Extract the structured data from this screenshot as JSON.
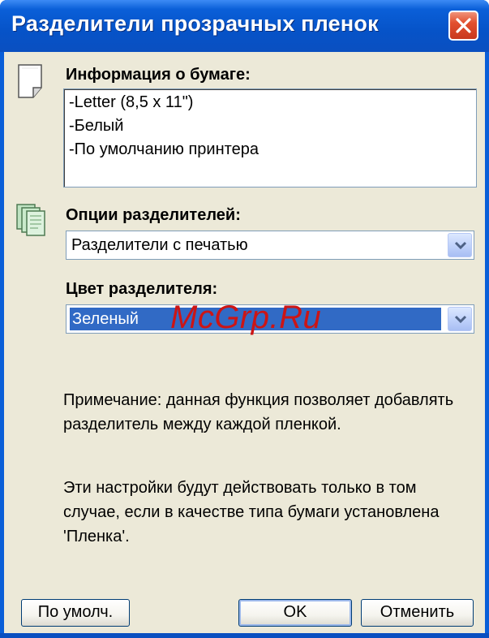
{
  "window": {
    "title": "Разделители прозрачных пленок",
    "close_icon": "close-icon"
  },
  "paper_info": {
    "label": "Информация о бумаге:",
    "icon": "paper-icon",
    "lines": [
      "-Letter (8,5 x 11\")",
      "-Белый",
      "-По умолчанию принтера"
    ]
  },
  "separator_options": {
    "label": "Опции разделителей:",
    "icon": "stack-icon",
    "selected": "Разделители с печатью"
  },
  "separator_color": {
    "label": "Цвет разделителя:",
    "selected": "Зеленый"
  },
  "watermark": "McGrp.Ru",
  "notes": {
    "note1": "Примечание: данная функция позволяет добавлять разделитель между каждой пленкой.",
    "note2": "Эти настройки будут действовать только в том случае, если в качестве типа бумаги установлена 'Пленка'."
  },
  "buttons": {
    "defaults": "По умолч.",
    "ok": "OK",
    "cancel": "Отменить"
  },
  "colors": {
    "titlebar": "#0A5FD8",
    "dialog_bg": "#ECE9D8",
    "selection": "#316AC5",
    "watermark": "#CC1515"
  }
}
